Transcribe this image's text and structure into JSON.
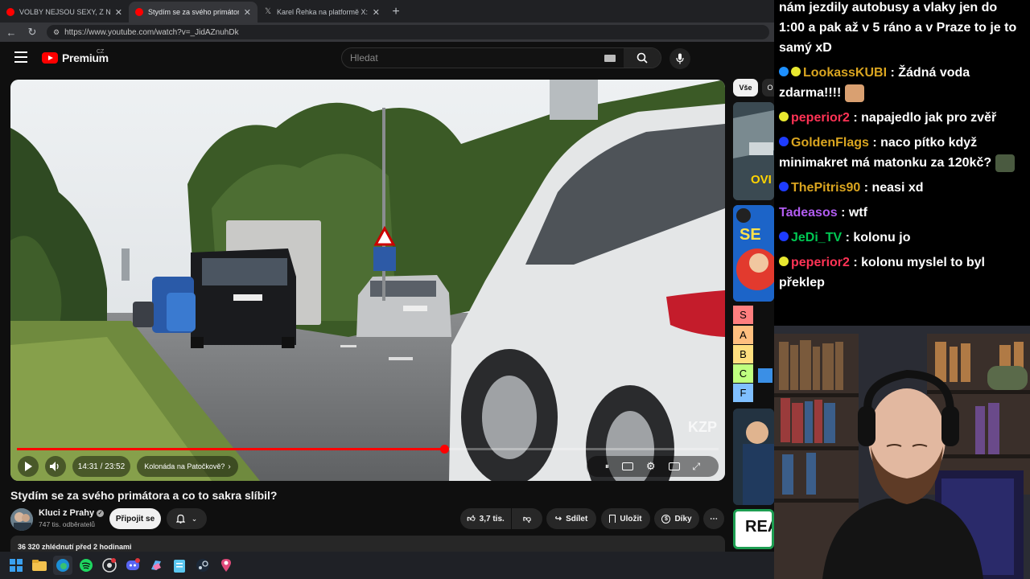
{
  "browser": {
    "tabs": [
      {
        "title": "VOLBY NEJSOU SEXY, Z NICH NE",
        "favicon_color": "#ff0000",
        "active": false
      },
      {
        "title": "Stydím se za svého primátora a co",
        "favicon_color": "#ff0000",
        "active": true
      },
      {
        "title": "Karel Řehka na platformě X: „Po v",
        "favicon_color": "#8a8a8a",
        "active": false
      }
    ],
    "address": "https://www.youtube.com/watch?v=_JidAZnuhDk"
  },
  "youtube": {
    "logo_text": "Premium",
    "country": "CZ",
    "search_placeholder": "Hledat",
    "player": {
      "time": "14:31 / 23:52",
      "chapter": "Kolonáda na Patočkově?",
      "progress": 0.6085,
      "watermark": "KZP"
    },
    "video_title": "Stydím se za svého primátora a co to sakra slíbil?",
    "channel": {
      "name": "Kluci z Prahy",
      "subscribers": "747 tis. odběratelů"
    },
    "join_label": "Připojit se",
    "actions": {
      "likes": "3,7 tis.",
      "share": "Sdílet",
      "save": "Uložit",
      "thanks": "Díky"
    },
    "description": "36 320 zhlédnutí  před 2 hodinami",
    "chips": {
      "all": "Vše",
      "next": "O"
    },
    "tier_letters": [
      "S",
      "A",
      "B",
      "C",
      "F"
    ],
    "tier_colors": [
      "#ff7f7f",
      "#ffbf7f",
      "#ffdf7f",
      "#bfff7f",
      "#7fbfff"
    ],
    "sidebar_thumb_text": "OVI",
    "sidebar_thumb_text2": "SE",
    "sidebar_thumb_text3": "REA"
  },
  "chat": {
    "messages": [
      {
        "user": "",
        "user_color": "#ffffff",
        "text": "nám jezdily autobusy a vlaky jen do 1:00 a pak až v 5 ráno a v Praze to je to samý xD",
        "badges": []
      },
      {
        "user": "LookassKUBI",
        "user_color": "#daa520",
        "text": " : Žádná voda zdarma!!!! ",
        "badges": [
          "#1e90ff",
          "#e8e830"
        ],
        "emote": true
      },
      {
        "user": "peperior2",
        "user_color": "#ff3355",
        "text": " : napajedlo jak pro zvěř",
        "badges": [
          "#e8e830"
        ]
      },
      {
        "user": "GoldenFlags",
        "user_color": "#daa520",
        "text": " : naco pítko když minimakret má matonku za 120kč? ",
        "badges": [
          "#1e3cff"
        ],
        "emote": true
      },
      {
        "user": "ThePitris90",
        "user_color": "#daa520",
        "text": " : neasi xd",
        "badges": [
          "#1e3cff"
        ]
      },
      {
        "user": "Tadeasos",
        "user_color": "#b15cf0",
        "text": " : wtf",
        "badges": []
      },
      {
        "user": "JeDi_TV",
        "user_color": "#00c853",
        "text": " : kolonu jo",
        "badges": [
          "#1e3cff"
        ]
      },
      {
        "user": "peperior2",
        "user_color": "#ff3355",
        "text": " : kolonu myslel to byl překlep",
        "badges": [
          "#e8e830"
        ]
      }
    ]
  },
  "taskbar": {
    "icons": [
      "windows-start-icon",
      "file-explorer-icon",
      "edge-icon",
      "spotify-icon",
      "obs-icon",
      "discord-icon",
      "copilot-icon",
      "notepad-icon",
      "steam-icon",
      "maps-icon"
    ]
  }
}
